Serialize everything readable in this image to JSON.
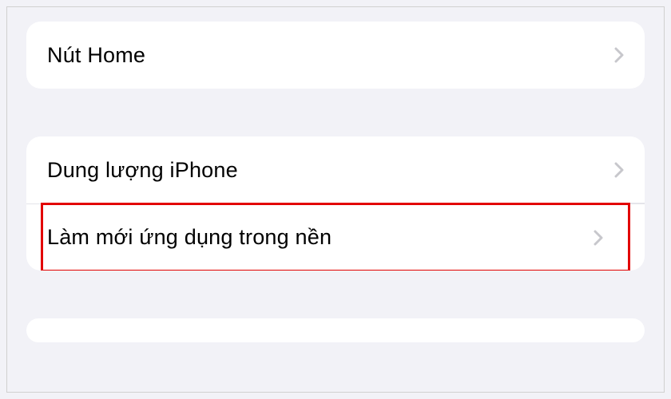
{
  "groups": [
    {
      "items": [
        {
          "label": "Nút Home"
        }
      ]
    },
    {
      "items": [
        {
          "label": "Dung lượng iPhone"
        },
        {
          "label": "Làm mới ứng dụng trong nền",
          "highlighted": true
        }
      ]
    }
  ]
}
